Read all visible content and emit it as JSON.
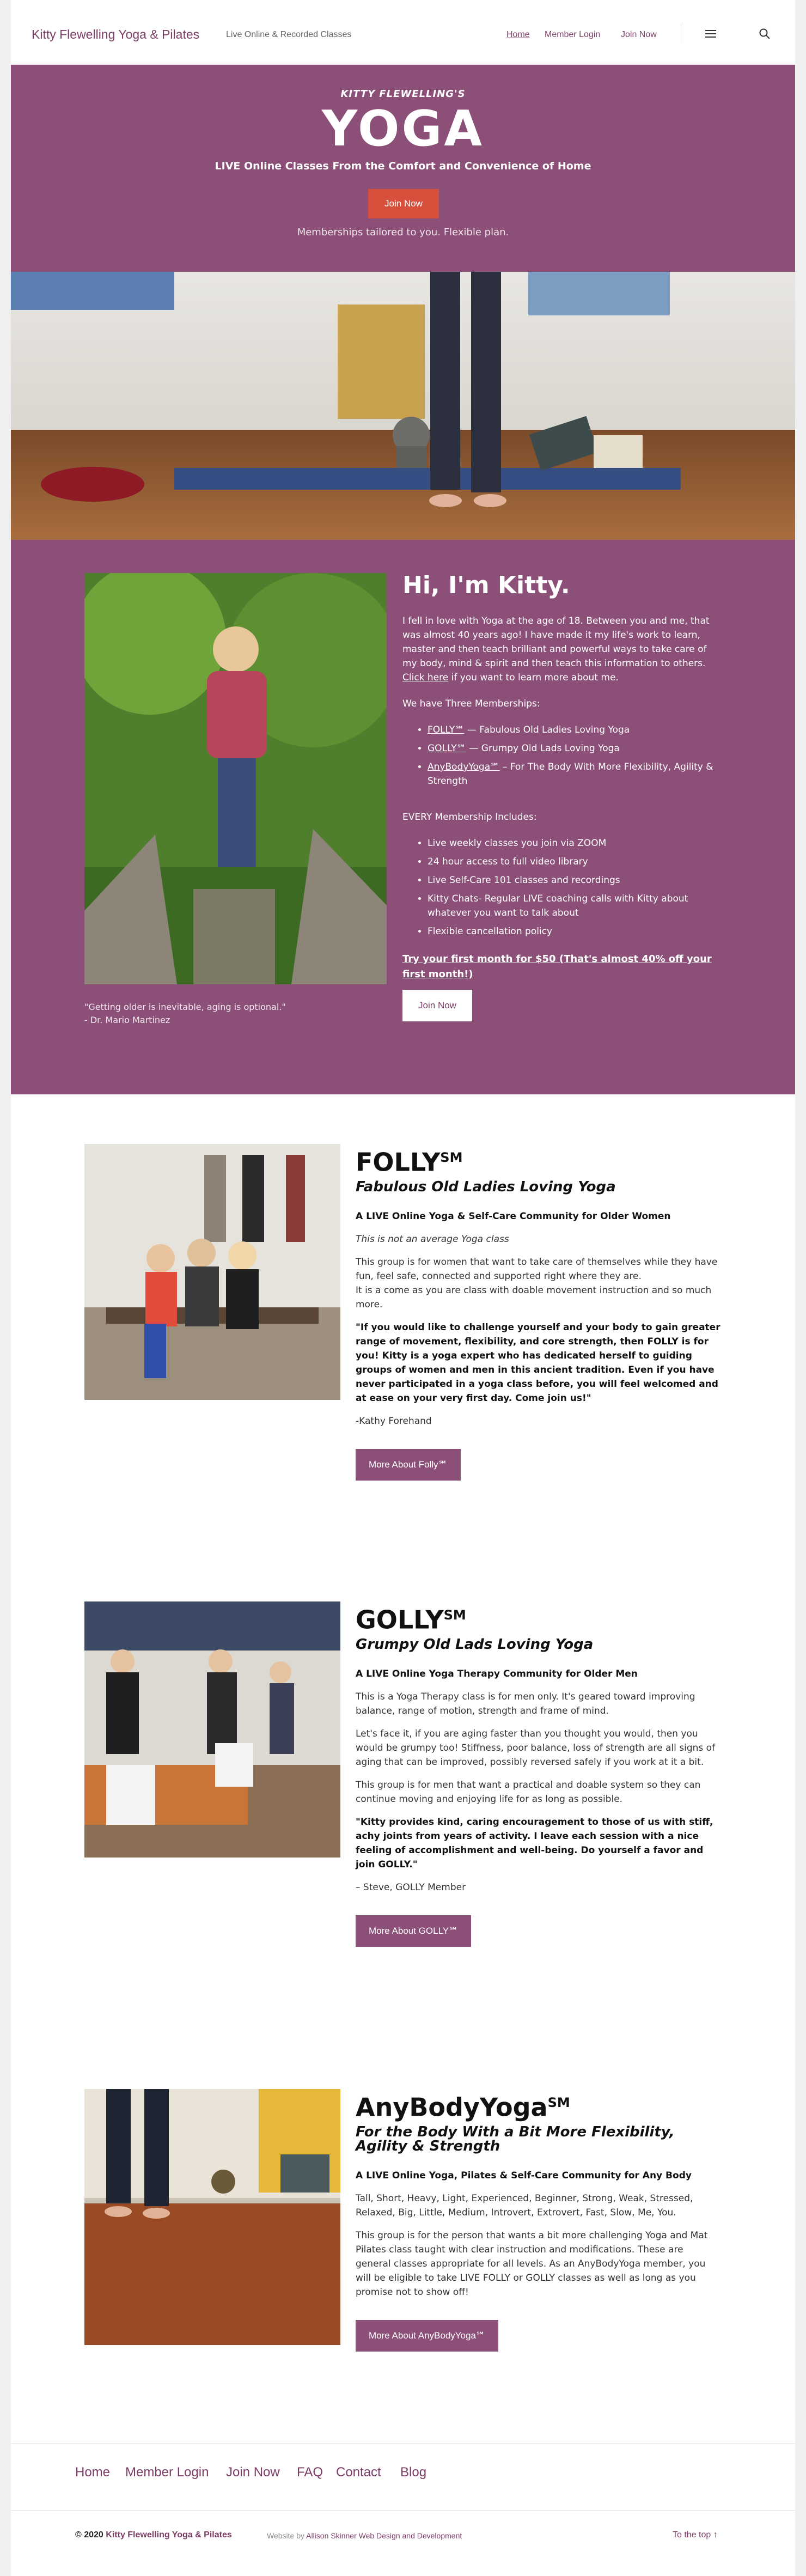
{
  "header": {
    "site_title": "Kitty Flewelling Yoga & Pilates",
    "tagline": "Live Online & Recorded Classes",
    "nav": [
      "Home",
      "Member Login",
      "Join Now"
    ]
  },
  "hero": {
    "kicker": "KITTY FLEWELLING'S",
    "title": "YOGA",
    "subtitle": "LIVE Online Classes From the Comfort and Convenience of Home",
    "button": "Join Now",
    "note": "Memberships tailored to you. Flexible plan."
  },
  "kitty": {
    "heading": "Hi, I'm Kitty.",
    "intro_before_link": "I fell in love with Yoga at the age of 18. Between you and me, that was almost 40 years ago! I have made it my life's work to learn, master and then teach brilliant and powerful ways to take care of my body, mind & spirit and then teach this information to others.",
    "intro_link": "Click here",
    "intro_after_link": "if you want to learn more about me.",
    "memberships_intro": "We have Three Memberships:",
    "memberships": [
      {
        "name": "FOLLY℠",
        "desc": " — Fabulous Old Ladies Loving Yoga"
      },
      {
        "name": "GOLLY℠",
        "desc": " — Grumpy Old Lads Loving Yoga"
      },
      {
        "name": "AnyBodyYoga℠",
        "desc": " – For The Body With More Flexibility, Agility & Strength"
      }
    ],
    "includes_intro": "EVERY Membership Includes:",
    "includes": [
      "Live weekly classes you join via ZOOM",
      "24 hour access to full video library",
      "Live Self-Care 101 classes and recordings",
      "Kitty Chats- Regular LIVE coaching calls with Kitty about whatever you want to talk about",
      "Flexible cancellation policy"
    ],
    "offer": "Try your first month for $50 (That's almost 40% off your first month!)",
    "button": "Join Now",
    "quote": "\"Getting older is inevitable, aging is optional.\"",
    "quote_author": "- Dr. Mario Martinez"
  },
  "folly": {
    "title": "FOLLY",
    "mark": "SM",
    "subtitle": "Fabulous Old Ladies Loving Yoga",
    "strap": "A LIVE Online Yoga & Self-Care Community for Older Women",
    "p1": "This is not an average Yoga class",
    "p2a": "This group is for women that want to take care of themselves while they have fun, feel safe, connected and supported right where they are.",
    "p2b": "It is a come as you are class with doable movement instruction and so much more.",
    "testimonial": "\"If you would like to challenge yourself and your body to gain greater range of movement, flexibility, and core strength, then FOLLY is for you! Kitty is a yoga expert who has dedicated herself to guiding groups of women and men in this ancient tradition. Even if you have never participated in a yoga class before, you will feel welcomed and at ease on your very first day. Come join us!\"",
    "author": "-Kathy Forehand",
    "button": "More About Folly℠"
  },
  "golly": {
    "title": "GOLLY",
    "mark": "SM",
    "subtitle": "Grumpy Old Lads Loving Yoga",
    "strap": "A LIVE Online Yoga Therapy Community for Older Men",
    "p1": "This is a Yoga Therapy class is for men only.  It's geared toward improving balance, range of motion, strength and frame of mind.",
    "p2": "Let's face it, if you are aging faster than you thought you would, then you would be grumpy too!  Stiffness, poor balance, loss of strength are all signs of aging that can be improved, possibly reversed safely if you work at it a bit.",
    "p3": "This group is for men that want a practical and doable system so they can continue moving and enjoying life for as long as possible.",
    "testimonial": "\"Kitty provides kind, caring encouragement to those of us with stiff, achy joints from years of activity. I leave each session with a nice feeling of accomplishment and well-being. Do yourself a favor and join GOLLY.\"",
    "author": "– Steve, GOLLY Member",
    "button": "More About GOLLY℠"
  },
  "anybody": {
    "title": "AnyBodyYoga",
    "mark": "SM",
    "subtitle": "For the Body With a Bit More Flexibility, Agility & Strength",
    "strap": "A LIVE Online Yoga, Pilates & Self-Care Community for Any Body",
    "p1": "Tall, Short, Heavy, Light, Experienced, Beginner, Strong, Weak, Stressed, Relaxed, Big, Little, Medium, Introvert, Extrovert, Fast, Slow, Me, You.",
    "p2": "This group is for the person that wants a bit more challenging Yoga and Mat Pilates class taught with clear instruction and modifications.  These are general classes appropriate for all levels.  As an AnyBodyYoga member, you will be eligible to take LIVE FOLLY or GOLLY classes as well as long as you promise not to show off!",
    "button": "More About AnyBodyYoga℠"
  },
  "footer": {
    "nav": [
      "Home",
      "Member Login",
      "Join Now",
      "FAQ",
      "Contact",
      "Blog"
    ],
    "copyright_prefix": "© 2020",
    "copyright_name": "Kitty Flewelling Yoga & Pilates",
    "credit_prefix": "Website by",
    "credit_name": "Allison Skinner Web Design and Development",
    "to_top": "To the top ↑"
  }
}
